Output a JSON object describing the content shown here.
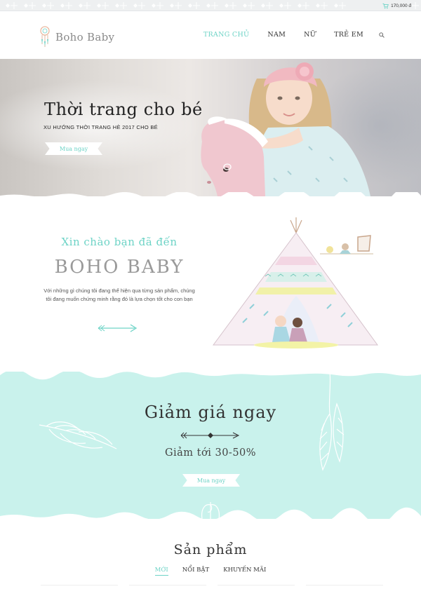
{
  "topbar": {
    "cart_total": "170,000 đ",
    "cart_icon": "cart-icon"
  },
  "header": {
    "logo_text": "Boho Baby",
    "logo_icon": "dreamcatcher-icon",
    "nav": [
      {
        "label": "TRANG CHỦ",
        "active": true
      },
      {
        "label": "NAM",
        "active": false
      },
      {
        "label": "NỮ",
        "active": false
      },
      {
        "label": "TRẺ EM",
        "active": false
      }
    ],
    "search_icon": "search-icon"
  },
  "hero": {
    "title": "Thời trang cho bé",
    "subtitle": "XU HƯỚNG THỜI TRANG HÈ 2017 CHO BÉ",
    "button": "Mua ngay"
  },
  "welcome": {
    "pre_title": "Xin chào bạn đã đến",
    "title": "BOHO BABY",
    "text": "Với những gì chúng tôi đang thể hiện qua từng sản phẩm, chúng tôi đang muốn chứng minh rằng đó là lựa chọn tốt cho con bạn",
    "arrow_icon": "arrow-right-icon"
  },
  "promo": {
    "title": "Giảm giá ngay",
    "subtitle": "Giảm tới 30-50%",
    "button": "Mua ngay"
  },
  "products": {
    "title": "Sản phẩm",
    "tabs": [
      {
        "label": "MỚI",
        "active": true
      },
      {
        "label": "NỔI BẬT",
        "active": false
      },
      {
        "label": "KHUYẾN MÃI",
        "active": false
      }
    ]
  },
  "colors": {
    "accent": "#6dd3c6",
    "promo_bg": "#c9f2ec",
    "strip_bg": "#eef0f1"
  }
}
